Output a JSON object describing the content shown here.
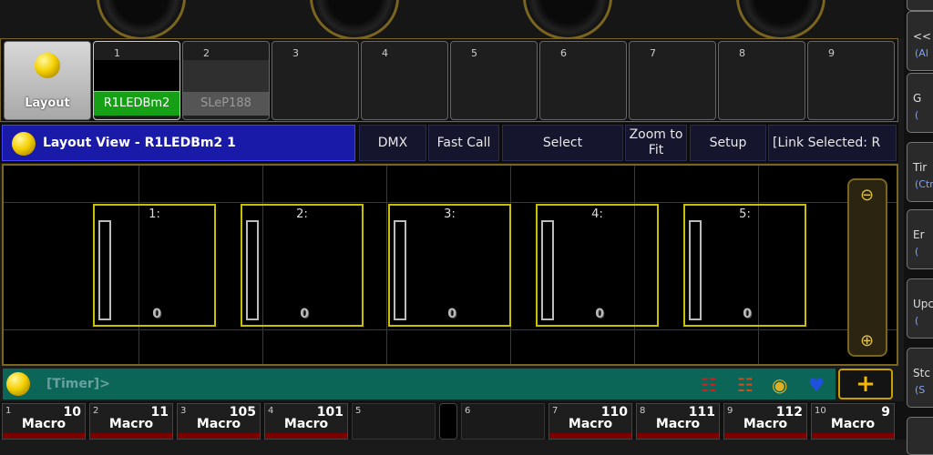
{
  "view_pool": {
    "layout_label": "Layout",
    "items": [
      {
        "num": "1",
        "label": "R1LEDBm2"
      },
      {
        "num": "2",
        "label": "SLeP188"
      },
      {
        "num": "3",
        "label": ""
      },
      {
        "num": "4",
        "label": ""
      },
      {
        "num": "5",
        "label": ""
      },
      {
        "num": "6",
        "label": ""
      },
      {
        "num": "7",
        "label": ""
      },
      {
        "num": "8",
        "label": ""
      },
      {
        "num": "9",
        "label": ""
      }
    ]
  },
  "title_bar": {
    "title": "Layout View - R1LEDBm2 1",
    "dmx": "DMX",
    "fast_call": "Fast Call",
    "select": "Select",
    "zoom_line1": "Zoom to",
    "zoom_line2": "Fit",
    "setup": "Setup",
    "link_selected": "[Link Selected: R"
  },
  "fixtures": [
    {
      "id": "1:",
      "value": "0"
    },
    {
      "id": "2:",
      "value": "0"
    },
    {
      "id": "3:",
      "value": "0"
    },
    {
      "id": "4:",
      "value": "0"
    },
    {
      "id": "5:",
      "value": "0"
    }
  ],
  "command_line": {
    "text": "[Timer]>"
  },
  "right_buttons": [
    {
      "l1": "<<",
      "l2": "(Al"
    },
    {
      "l1": "G",
      "l2": "("
    },
    {
      "l1": "Tir",
      "l2": "(Ctr"
    },
    {
      "l1": "Er",
      "l2": "("
    },
    {
      "l1": "Upc",
      "l2": "("
    },
    {
      "l1": "Stc",
      "l2": "(S"
    }
  ],
  "executors": [
    {
      "no": "1",
      "value": "10",
      "name": "Macro"
    },
    {
      "no": "2",
      "value": "11",
      "name": "Macro"
    },
    {
      "no": "3",
      "value": "105",
      "name": "Macro"
    },
    {
      "no": "4",
      "value": "101",
      "name": "Macro"
    },
    {
      "no": "5",
      "value": "",
      "name": ""
    },
    {
      "no": "6",
      "value": "",
      "name": ""
    },
    {
      "no": "7",
      "value": "110",
      "name": "Macro"
    },
    {
      "no": "8",
      "value": "111",
      "name": "Macro"
    },
    {
      "no": "9",
      "value": "112",
      "name": "Macro"
    },
    {
      "no": "10",
      "value": "9",
      "name": "Macro"
    }
  ],
  "colors": {
    "accent_gold": "#7a6520",
    "title_blue": "#1a1aa8",
    "command_teal": "#0b6658",
    "fixture_yellow": "#c8c000",
    "active_green": "#16a016"
  }
}
